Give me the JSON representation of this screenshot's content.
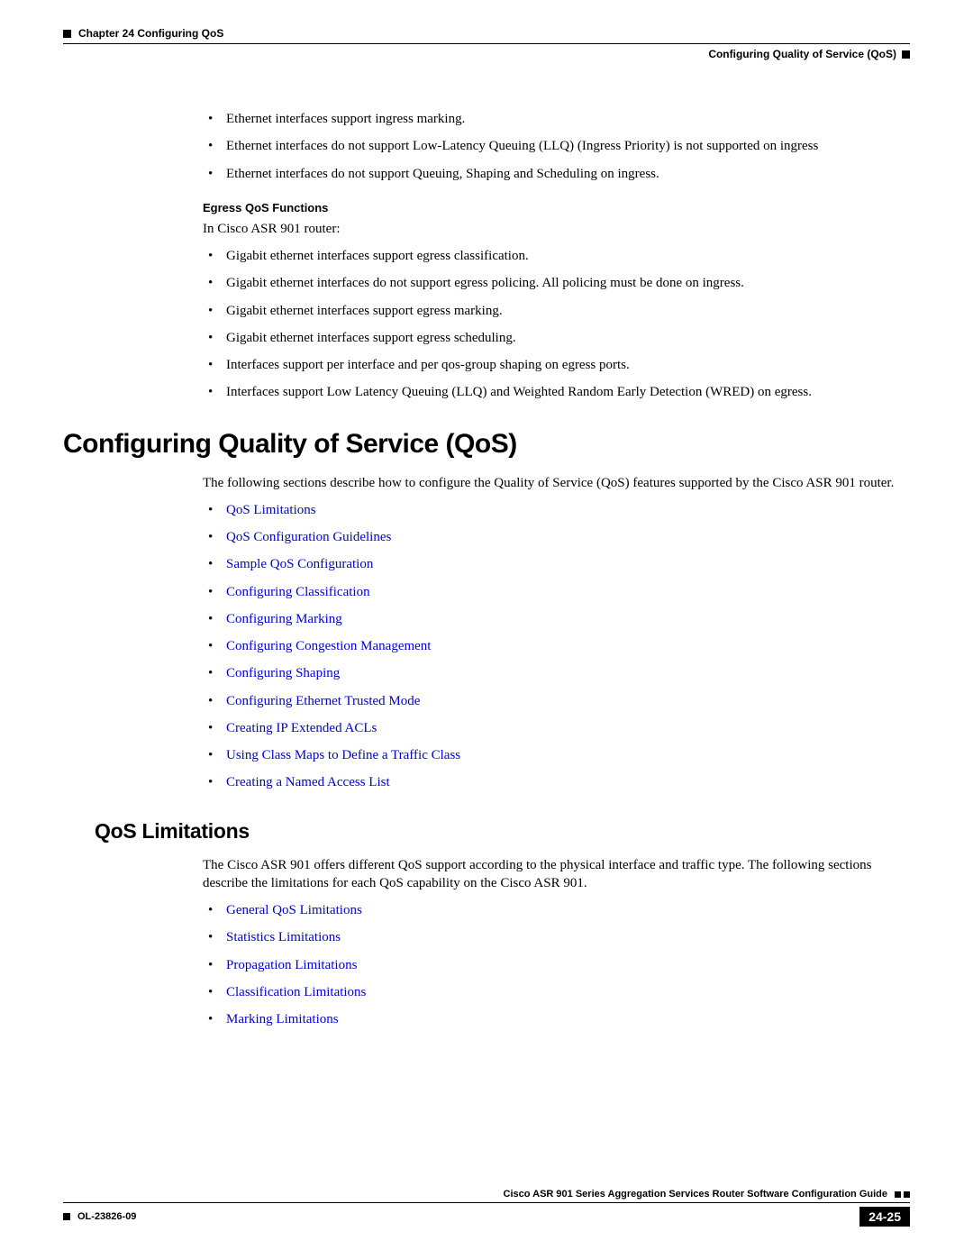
{
  "header": {
    "chapter_label": "Chapter 24    Configuring QoS",
    "section_label": "Configuring Quality of Service (QoS)"
  },
  "ingress_bullets": [
    "Ethernet interfaces support ingress marking.",
    "Ethernet interfaces do not support Low-Latency Queuing (LLQ) (Ingress Priority) is not supported on ingress",
    "Ethernet interfaces do not support Queuing, Shaping and Scheduling on ingress."
  ],
  "egress": {
    "heading": "Egress QoS Functions",
    "intro": "In Cisco ASR 901 router:",
    "bullets": [
      "Gigabit ethernet interfaces support egress classification.",
      "Gigabit ethernet interfaces do not support egress policing. All policing must be done on ingress.",
      "Gigabit ethernet interfaces support egress marking.",
      "Gigabit ethernet interfaces support egress scheduling.",
      "Interfaces support per interface and per qos-group shaping on egress ports.",
      "Interfaces support Low Latency Queuing (LLQ) and Weighted Random Early Detection (WRED) on egress."
    ]
  },
  "main": {
    "heading": "Configuring Quality of Service (QoS)",
    "intro": "The following sections describe how to configure the Quality of Service (QoS) features supported by the Cisco ASR 901 router.",
    "links": [
      "QoS Limitations",
      "QoS Configuration Guidelines",
      "Sample QoS Configuration",
      "Configuring Classification",
      "Configuring Marking",
      "Configuring Congestion Management",
      "Configuring Shaping",
      "Configuring Ethernet Trusted Mode",
      "Creating IP Extended ACLs",
      "Using Class Maps to Define a Traffic Class",
      "Creating a Named Access List"
    ]
  },
  "limitations": {
    "heading": "QoS Limitations",
    "intro": "The Cisco ASR 901 offers different QoS support according to the physical interface and traffic type. The following sections describe the limitations for each QoS capability on the Cisco ASR 901.",
    "links": [
      "General QoS Limitations",
      "Statistics Limitations",
      "Propagation Limitations",
      "Classification Limitations",
      "Marking Limitations"
    ]
  },
  "footer": {
    "guide": "Cisco ASR 901 Series Aggregation Services Router Software Configuration Guide",
    "doc_id": "OL-23826-09",
    "page": "24-25"
  }
}
